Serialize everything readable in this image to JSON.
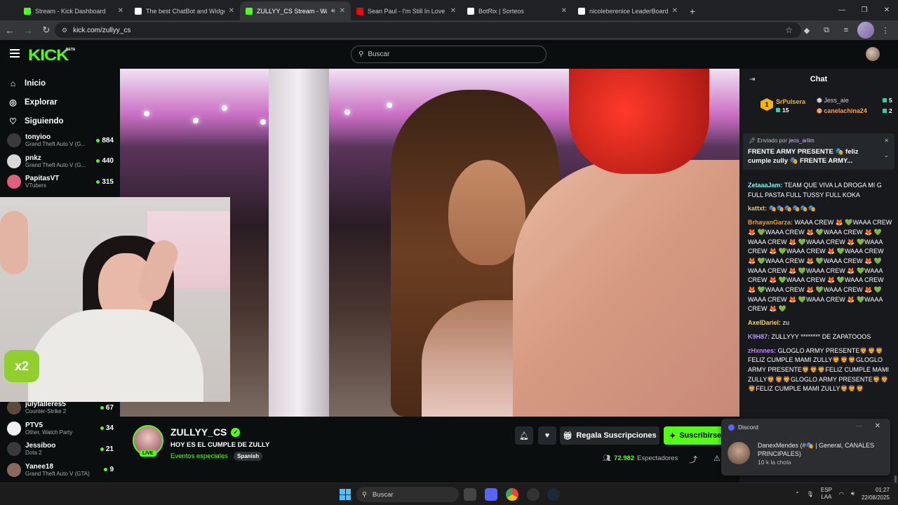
{
  "browser": {
    "tabs": [
      {
        "title": "Stream - Kick Dashboard",
        "icon": "kick-icon",
        "color": "#53fc18"
      },
      {
        "title": "The best ChatBot and Widgets",
        "icon": "botrix-icon",
        "color": "#ffffff"
      },
      {
        "title": "ZULLYY_CS Stream - Watch",
        "icon": "kick-icon",
        "color": "#53fc18",
        "active": true
      },
      {
        "title": "Sean Paul - I'm Still In Love With",
        "icon": "youtube-icon",
        "color": "#ff0000"
      },
      {
        "title": "BotRix | Sorteos",
        "icon": "botrix-icon",
        "color": "#ffffff"
      },
      {
        "title": "nicoleberenice LeaderBoard | T",
        "icon": "botrix-icon",
        "color": "#ffffff"
      }
    ],
    "url": "kick.com/zullyy_cs"
  },
  "kick": {
    "logo": "KICK",
    "beta": "BETA",
    "search_placeholder": "Buscar",
    "accent": "#53fc18"
  },
  "sidebar": {
    "menu": [
      {
        "label": "Inicio",
        "icon": "home-icon"
      },
      {
        "label": "Explorar",
        "icon": "compass-icon"
      },
      {
        "label": "Siguiendo",
        "icon": "heart-icon"
      }
    ],
    "channels_top": [
      {
        "name": "tonyioo",
        "category": "Grand Theft Auto V (G...",
        "viewers": "884",
        "avatar": "#3a3a3a"
      },
      {
        "name": "pnkz",
        "category": "Grand Theft Auto V (G...",
        "viewers": "440",
        "avatar": "#d8d8d8"
      },
      {
        "name": "PapitasVT",
        "category": "VTubers",
        "viewers": "315",
        "avatar": "#e06080"
      }
    ],
    "channels_bottom": [
      {
        "name": "julytalleres5",
        "category": "Counter-Strike 2",
        "viewers": "67",
        "avatar": "#5a4a3a"
      },
      {
        "name": "PTV5",
        "category": "Other, Watch Party",
        "viewers": "34",
        "avatar": "#f0f0f0"
      },
      {
        "name": "Jessiboo",
        "category": "Dota 2",
        "viewers": "21",
        "avatar": "#3a3a3a"
      },
      {
        "name": "Yanee18",
        "category": "Grand Theft Auto V (GTA)",
        "viewers": "9",
        "avatar": "#8a6a5a"
      }
    ]
  },
  "stream": {
    "name": "ZULLYY_CS",
    "live": "LIVE",
    "title": "HOY ES EL CUMPLE DE ZULLY",
    "category": "Eventos especiales",
    "language": "Spanish",
    "gift_label": "Regala Suscripciones",
    "subscribe_label": "Suscribirse",
    "viewers": "72.982",
    "viewers_label": "Espectadores",
    "webcam_badge": "x2"
  },
  "chat": {
    "title": "Chat",
    "gifters": [
      {
        "name": "SrPulsera",
        "count": "15",
        "rank": "1",
        "color": "#f2b705"
      },
      {
        "name": "Jess_aie",
        "count": "5",
        "color": "#aaaaaa"
      },
      {
        "name": "canelachina24",
        "count": "2",
        "color": "#f4a261"
      }
    ],
    "pinned": {
      "sent_by_label": "Enviado por",
      "sent_by": "jeos_arlim",
      "text": "FRENTE ARMY PRESENTE 🎭 feliz cumple zully 🎭 FRENTE ARMY..."
    },
    "messages": [
      {
        "user": "ZetaaaJam",
        "text": " TEAM QUE VIVA LA DROGA MI G FULL PASTA FULL TUSSY FULL KOKA",
        "cls": "u1"
      },
      {
        "user": "kattxt",
        "text": " 🎭🎭🎭🎭🎭🎭",
        "cls": "u2"
      },
      {
        "user": "BrhayanGarza",
        "text": " WAAA CREW 🦊 💚WAAA CREW 🦊 💚WAAA CREW 🦊 💚WAAA CREW 🦊 💚WAAA CREW 🦊 💚WAAA CREW 🦊 💚WAAA CREW 🦊 💚WAAA CREW 🦊 💚WAAA CREW 🦊 💚WAAA CREW 🦊 💚WAAA CREW 🦊 💚WAAA CREW 🦊 💚WAAA CREW 🦊 💚WAAA CREW 🦊 💚WAAA CREW 🦊 💚WAAA CREW 🦊 💚WAAA CREW 🦊 💚WAAA CREW 🦊 💚WAAA CREW 🦊 💚WAAA CREW 🦊 💚WAAA CREW 🦊 💚",
        "cls": "u3"
      },
      {
        "user": "AxelDariel",
        "text": " zu",
        "cls": "u4"
      },
      {
        "user": "K9H87",
        "text": " ZULLYYY ******** DE ZAPATOOOS",
        "cls": "u5"
      },
      {
        "user": "zHxnnes",
        "text": " GLOGLO ARMY PRESENTE🦁🦁🦁 FELIZ CUMPLE MAMI ZULLY🦁🦁🦁GLOGLO ARMY PRESENTE🦁🦁🦁FELIZ CUMPLE MAMI ZULLY🦁🦁🦁GLOGLO ARMY PRESENTE🦁🦁🦁FELIZ CUMPLE MAMI ZULLY🦁🦁🦁",
        "cls": "u6"
      }
    ]
  },
  "discord": {
    "app": "Discord",
    "line1": "DanexMendes (#🎭 | General, CANALES PRINCIPALES)",
    "line2": "10 k la chola"
  },
  "taskbar": {
    "search": "Buscar",
    "lang1": "ESP",
    "lang2": "LAA",
    "time": "01:27",
    "date": "22/08/2025"
  }
}
